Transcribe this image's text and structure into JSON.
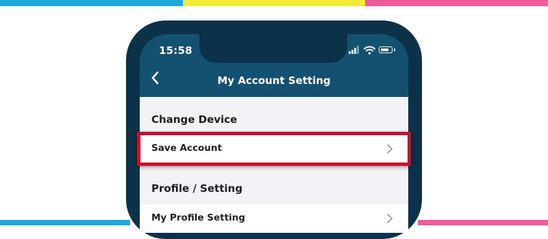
{
  "colors": {
    "stripe_blue": "#22a8d9",
    "stripe_yellow": "#f2ea3a",
    "stripe_pink": "#ee5a9b",
    "phone_frame": "#0b3248",
    "nav_bar": "#14506f",
    "highlight": "#c8102e",
    "list_background": "#f2f2f7"
  },
  "status_bar": {
    "time": "15:58",
    "icons": [
      "signal-icon",
      "wifi-icon",
      "battery-icon"
    ]
  },
  "nav": {
    "back_icon": "chevron-left-icon",
    "title": "My Account Setting"
  },
  "sections": [
    {
      "header": "Change Device",
      "rows": [
        {
          "label": "Save Account",
          "icon": "chevron-right-icon",
          "highlighted": true
        }
      ]
    },
    {
      "header": "Profile / Setting",
      "rows": [
        {
          "label": "My Profile Setting",
          "icon": "chevron-right-icon"
        }
      ]
    }
  ]
}
